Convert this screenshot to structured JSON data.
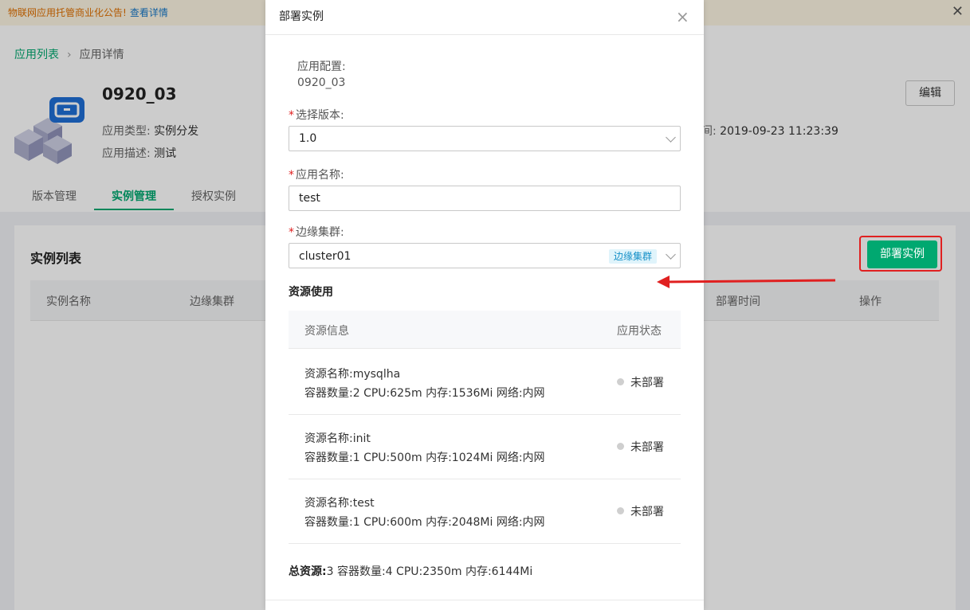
{
  "notice": {
    "text": "物联网应用托管商业化公告!",
    "link": "查看详情"
  },
  "breadcrumb": {
    "root": "应用列表",
    "current": "应用详情"
  },
  "app": {
    "name": "0920_03",
    "type_label": "应用类型:",
    "type_value": "实例分发",
    "desc_label": "应用描述:",
    "desc_value": "测试",
    "time_partial_label": "间:",
    "time_value": "2019-09-23 11:23:39"
  },
  "edit_label": "编辑",
  "tabs": [
    "版本管理",
    "实例管理",
    "授权实例"
  ],
  "instances": {
    "title": "实例列表",
    "deploy_button": "部署实例",
    "columns": [
      "实例名称",
      "边缘集群",
      "部署时间",
      "操作"
    ]
  },
  "modal": {
    "title": "部署实例",
    "config_label": "应用配置:",
    "config_value": "0920_03",
    "version_label": "选择版本:",
    "version_value": "1.0",
    "name_label": "应用名称:",
    "name_value": "test",
    "cluster_label": "边缘集群:",
    "cluster_value": "cluster01",
    "cluster_tag": "边缘集群",
    "resources_title": "资源使用",
    "resources_cols": [
      "资源信息",
      "应用状态"
    ],
    "resources": [
      {
        "name": "资源名称:mysqlha",
        "detail": "容器数量:2  CPU:625m  内存:1536Mi  网络:内网",
        "status": "未部署"
      },
      {
        "name": "资源名称:init",
        "detail": "容器数量:1  CPU:500m  内存:1024Mi  网络:内网",
        "status": "未部署"
      },
      {
        "name": "资源名称:test",
        "detail": "容器数量:1  CPU:600m  内存:2048Mi  网络:内网",
        "status": "未部署"
      }
    ],
    "total_label": "总资源:",
    "total_value": "3  容器数量:4  CPU:2350m  内存:6144Mi"
  },
  "colors": {
    "accent": "#00a870",
    "highlight": "#e02020",
    "link": "#1677c8"
  }
}
